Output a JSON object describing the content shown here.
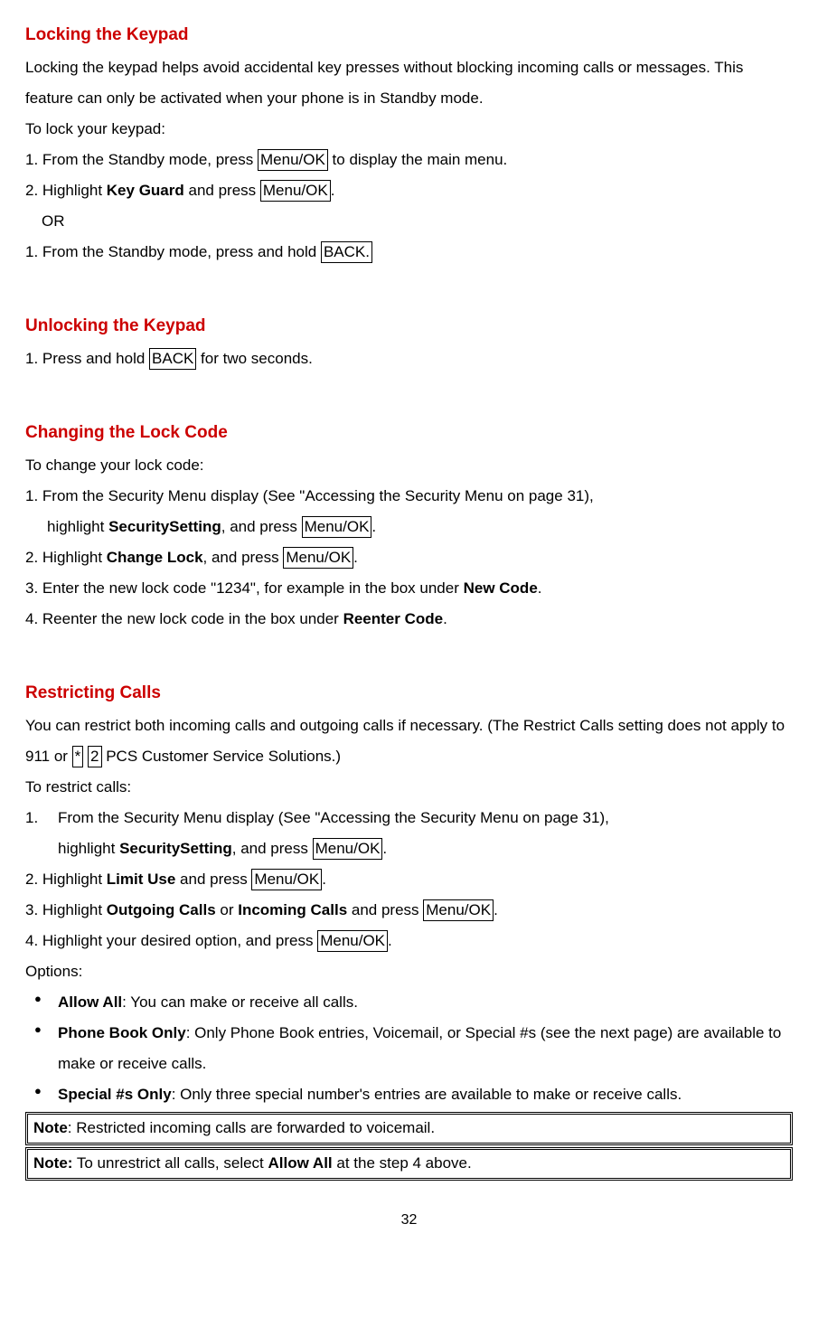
{
  "sections": {
    "locking": {
      "heading": "Locking the Keypad",
      "intro": "Locking the keypad helps avoid accidental key presses without blocking incoming calls or messages. This feature can only be activated when your phone is in Standby mode.",
      "toLock": "To lock your keypad:",
      "step1_pre": "1. From the Standby mode, press ",
      "step1_key": "Menu/OK",
      "step1_post": " to display the main menu.",
      "step2_pre": "2. Highlight ",
      "step2_bold": "Key Guard",
      "step2_mid": " and press ",
      "step2_key": "Menu/OK",
      "step2_post": ".",
      "or": "OR",
      "alt_pre": "1. From the Standby mode, press and hold ",
      "alt_key": "BACK.",
      "alt_post": ""
    },
    "unlocking": {
      "heading": "Unlocking the Keypad",
      "step_pre": "1. Press and hold ",
      "step_key": "BACK",
      "step_post": " for two seconds."
    },
    "changing": {
      "heading": "Changing the Lock Code",
      "intro": "To change your lock code:",
      "step1_line1": "1. From the Security Menu display (See \"Accessing the Security Menu on page 31),",
      "step1_line2_pre": "highlight ",
      "step1_line2_bold": "SecuritySetting",
      "step1_line2_mid": ", and press ",
      "step1_line2_key": "Menu/OK",
      "step1_line2_post": ".",
      "step2_pre": "2. Highlight ",
      "step2_bold": "Change Lock",
      "step2_mid": ", and press ",
      "step2_key": "Menu/OK",
      "step2_post": ".",
      "step3_pre": "3. Enter the new lock code \"1234\", for example in the box under ",
      "step3_bold": "New Code",
      "step3_post": ".",
      "step4_pre": "4. Reenter the new lock code in the box under ",
      "step4_bold": "Reenter Code",
      "step4_post": "."
    },
    "restricting": {
      "heading": "Restricting Calls",
      "intro_pre": "You can restrict both incoming calls and outgoing calls if necessary. (The Restrict Calls setting does not apply to 911 or ",
      "intro_key1": "*",
      "intro_key2": "2",
      "intro_post": " PCS Customer Service Solutions.)",
      "toRestrict": "To restrict calls:",
      "step1_num": "1.",
      "step1_line1": "From the Security Menu display (See \"Accessing the Security Menu on page 31),",
      "step1_line2_pre": "highlight ",
      "step1_line2_bold": "SecuritySetting",
      "step1_line2_mid": ", and press ",
      "step1_line2_key": "Menu/OK",
      "step1_line2_post": ".",
      "step2_pre": "2. Highlight ",
      "step2_bold": "Limit Use",
      "step2_mid": " and press ",
      "step2_key": "Menu/OK",
      "step2_post": ".",
      "step3_pre": "3. Highlight ",
      "step3_bold1": "Outgoing Calls",
      "step3_mid1": " or ",
      "step3_bold2": "Incoming Calls",
      "step3_mid2": " and press ",
      "step3_key": "Menu/OK",
      "step3_post": ".",
      "step4_pre": "4. Highlight your desired option, and press ",
      "step4_key": "Menu/OK",
      "step4_post": ".",
      "optionsLabel": "Options:",
      "opt1_bold": "Allow All",
      "opt1_text": ": You can make or receive all calls.",
      "opt2_bold": "Phone Book Only",
      "opt2_text": ": Only Phone Book entries, Voicemail, or Special #s (see the next page) are available to make or receive calls.",
      "opt3_bold": "Special #s Only",
      "opt3_text": ": Only three special number's entries are available to make or receive calls.",
      "note1_bold": "Note",
      "note1_text": ": Restricted incoming calls are forwarded to voicemail.",
      "note2_bold": "Note:",
      "note2_pre": " To unrestrict all calls, select ",
      "note2_allow": "Allow All",
      "note2_post": " at the step 4 above."
    }
  },
  "pageNumber": "32"
}
